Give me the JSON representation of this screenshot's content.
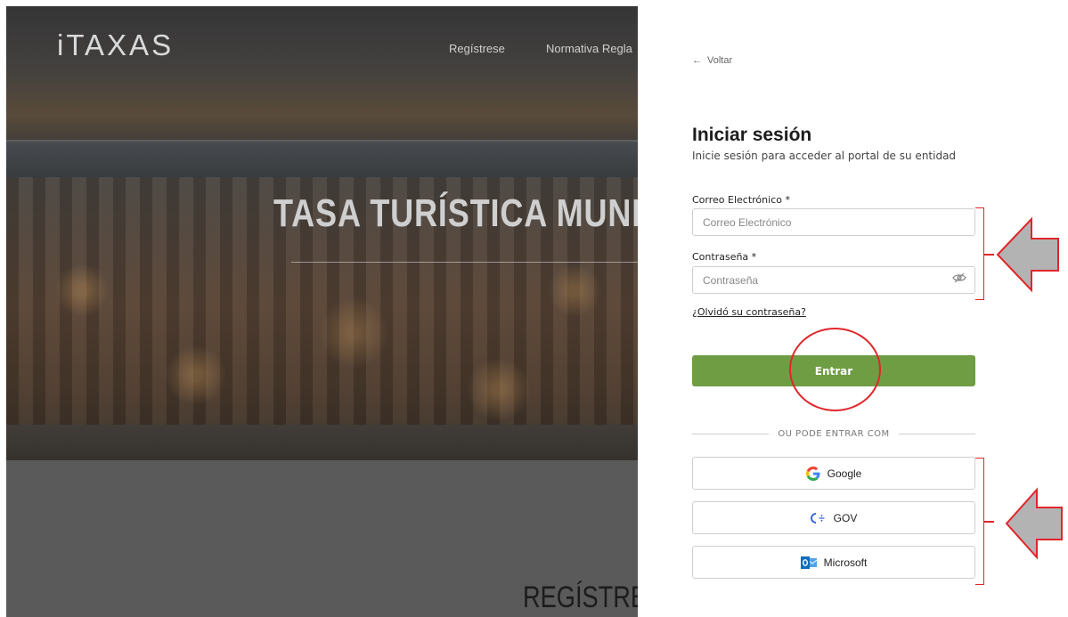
{
  "background": {
    "logo": "iTAXAS",
    "nav": [
      "Regístrese",
      "Normativa Regla"
    ],
    "hero_title": "TASA TURÍSTICA MUNIC",
    "section_title": "REGÍSTRESE"
  },
  "login": {
    "back_label": "Voltar",
    "title": "Iniciar sesión",
    "subtitle": "Inicie sesión para acceder al portal de su entidad",
    "email": {
      "label": "Correo Electrónico *",
      "placeholder": "Correo Electrónico",
      "value": ""
    },
    "password": {
      "label": "Contraseña *",
      "placeholder": "Contraseña",
      "value": ""
    },
    "forgot_label": "¿Olvidó su contraseña?",
    "submit_label": "Entrar",
    "divider_text": "OU PODE ENTRAR COM",
    "providers": [
      {
        "name": "Google",
        "icon": "google-icon"
      },
      {
        "name": "GOV",
        "icon": "gov-icon"
      },
      {
        "name": "Microsoft",
        "icon": "outlook-icon"
      }
    ]
  },
  "colors": {
    "accent": "#6e9d43",
    "annotation": "#e0262b",
    "annotation_arrow_fill": "#b3b3b3"
  }
}
